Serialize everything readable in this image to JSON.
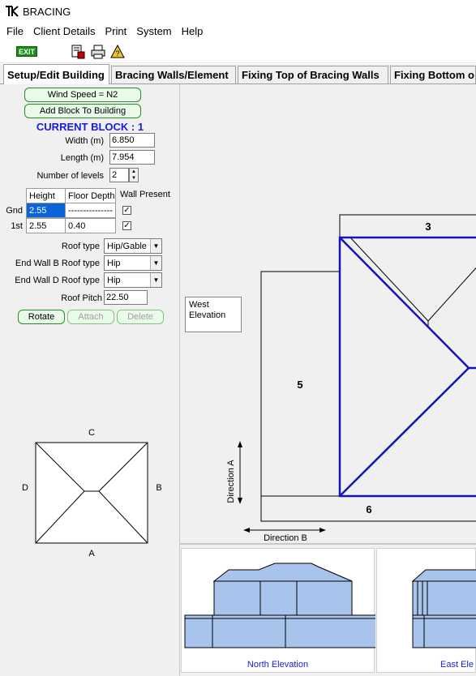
{
  "window": {
    "title": "BRACING"
  },
  "menu": [
    "File",
    "Client Details",
    "Print",
    "System",
    "Help"
  ],
  "toolbar": {
    "exit_label": "EXIT",
    "icons": [
      "save-report-icon",
      "print-icon",
      "help-icon"
    ]
  },
  "tabs": [
    {
      "label": "Setup/Edit Building",
      "active": true
    },
    {
      "label": "Bracing Walls/Element",
      "active": false
    },
    {
      "label": "Fixing Top of Bracing Walls",
      "active": false
    },
    {
      "label": "Fixing Bottom o",
      "active": false
    }
  ],
  "setup": {
    "wind_speed_button": "Wind Speed = N2",
    "add_block_button": "Add Block To Building",
    "current_block": "CURRENT BLOCK : 1",
    "width_label": "Width (m)",
    "width_value": "6.850",
    "length_label": "Length (m)",
    "length_value": "7.954",
    "levels_label": "Number of levels",
    "levels_value": "2",
    "grid": {
      "col_height": "Height",
      "col_floor_depth": "Floor Depth",
      "col_wall_present": "Wall Present",
      "rows": [
        {
          "level": "Gnd",
          "height": "2.55",
          "floor_depth": "---------------",
          "wall_present": true
        },
        {
          "level": "1st",
          "height": "2.55",
          "floor_depth": "0.40",
          "wall_present": true
        }
      ]
    },
    "roof_type_label": "Roof type",
    "roof_type_value": "Hip/Gable",
    "end_wall_b_label": "End Wall B Roof type",
    "end_wall_b_value": "Hip",
    "end_wall_d_label": "End Wall D Roof type",
    "end_wall_d_value": "Hip",
    "roof_pitch_label": "Roof Pitch",
    "roof_pitch_value": "22.50",
    "rotate_button": "Rotate",
    "attach_button": "Attach",
    "delete_button": "Delete"
  },
  "roof_diagram": {
    "top": "C",
    "left": "D",
    "right": "B",
    "bottom": "A"
  },
  "plan": {
    "west_label": "West\nElevation",
    "block_3": "3",
    "block_5": "5",
    "block_6": "6",
    "direction_a": "Direction A",
    "direction_b": "Direction B",
    "highlight_color": "#1414b4"
  },
  "elevations": [
    {
      "label": "North Elevation"
    },
    {
      "label": "East Ele"
    }
  ]
}
